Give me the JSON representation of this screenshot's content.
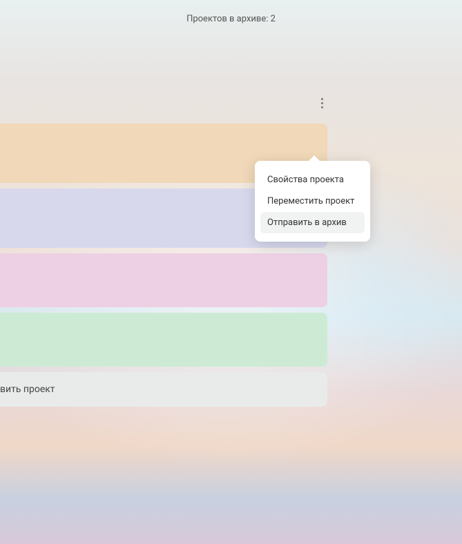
{
  "header": {
    "archive_count_text": "Проектов в архиве: 2"
  },
  "projects": {
    "cards": [
      {
        "color": "orange"
      },
      {
        "color": "lilac"
      },
      {
        "color": "pink"
      },
      {
        "color": "green"
      }
    ],
    "add_button_label": "вить проект"
  },
  "context_menu": {
    "items": [
      {
        "label": "Свойства проекта",
        "highlighted": false
      },
      {
        "label": "Переместить проект",
        "highlighted": false
      },
      {
        "label": "Отправить в архив",
        "highlighted": true
      }
    ]
  }
}
